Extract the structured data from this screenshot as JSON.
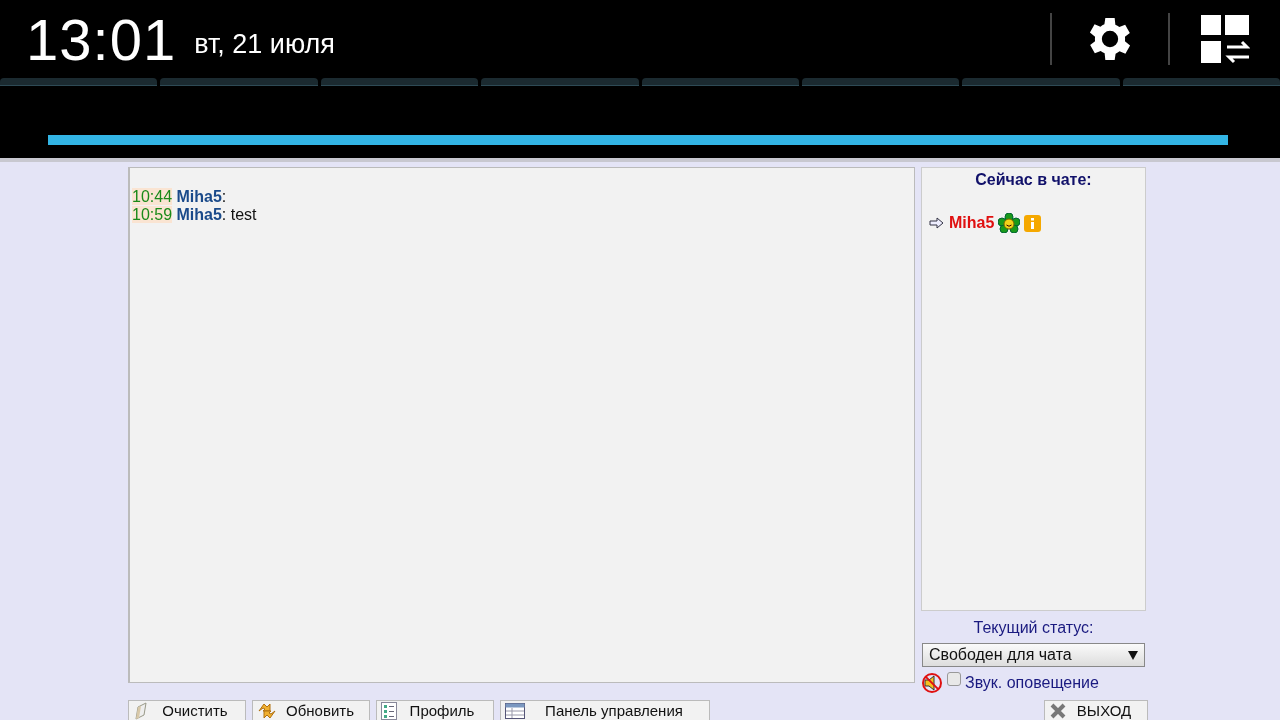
{
  "status_bar": {
    "time": "13:01",
    "date": "вт, 21 июля"
  },
  "progress": {
    "level": 1
  },
  "messages": [
    {
      "time": "10:44",
      "author": "Miha5",
      "text": ":"
    },
    {
      "time": "10:59",
      "author": "Miha5",
      "text": ": test"
    }
  ],
  "online": {
    "title": "Сейчас в чате:",
    "users": [
      {
        "name": "Miha5"
      }
    ]
  },
  "status": {
    "label": "Текущий статус:",
    "value": "Свободен для чата"
  },
  "sound": {
    "label": "Звук. оповещение",
    "checked": false
  },
  "buttons": [
    {
      "label": "Очистить",
      "kind": "eraser"
    },
    {
      "label": "Обновить",
      "kind": "refresh"
    },
    {
      "label": "Профиль",
      "kind": "list"
    },
    {
      "label": "Панель управления",
      "kind": "table"
    }
  ],
  "exit": {
    "label": "ВЫХОД"
  }
}
